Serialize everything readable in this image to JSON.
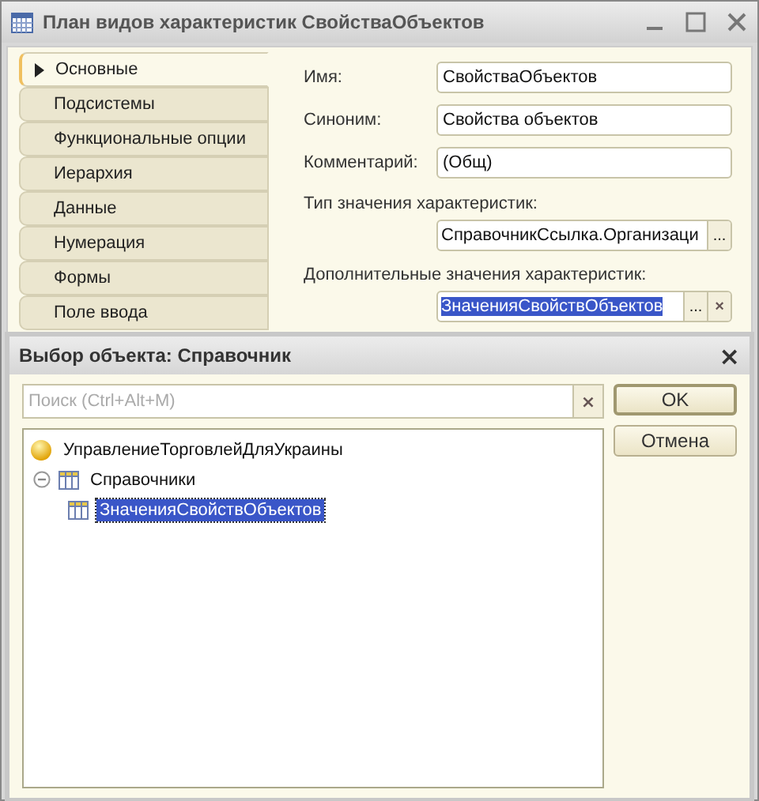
{
  "window": {
    "title": "План видов характеристик СвойстваОбъектов"
  },
  "tabs": [
    {
      "label": "Основные",
      "selected": true
    },
    {
      "label": "Подсистемы",
      "selected": false
    },
    {
      "label": "Функциональные опции",
      "selected": false
    },
    {
      "label": "Иерархия",
      "selected": false
    },
    {
      "label": "Данные",
      "selected": false
    },
    {
      "label": "Нумерация",
      "selected": false
    },
    {
      "label": "Формы",
      "selected": false
    },
    {
      "label": "Поле ввода",
      "selected": false
    }
  ],
  "fields": [
    {
      "kind": "inline",
      "label": "Имя:",
      "value": "СвойстваОбъектов"
    },
    {
      "kind": "inline",
      "label": "Синоним:",
      "value": "Свойства объектов"
    },
    {
      "kind": "inline",
      "label": "Комментарий:",
      "value": "(Общ)"
    },
    {
      "kind": "choice",
      "label": "Тип значения характеристик:",
      "value": "СправочникСсылка.Организаци",
      "button": "...",
      "highlighted": false
    },
    {
      "kind": "choice-clear",
      "label": "Дополнительные значения характеристик:",
      "value": "ЗначенияСвойствОбъектов",
      "button": "...",
      "clear": "×",
      "highlighted": true
    }
  ],
  "dialog": {
    "title": "Выбор объекта: Справочник",
    "close": "×",
    "search": {
      "placeholder": "Поиск (Ctrl+Alt+M)",
      "clear": "×"
    },
    "buttons": [
      {
        "label": "OK",
        "default": true
      },
      {
        "label": "Отмена",
        "default": false
      }
    ],
    "tree": [
      {
        "kind": "root",
        "label": "УправлениеТорговлейДляУкраины",
        "selected": false,
        "children": [
          {
            "kind": "group",
            "label": "Справочники",
            "expanded": true,
            "selected": false,
            "children": [
              {
                "kind": "item",
                "label": "ЗначенияСвойствОбъектов",
                "selected": true
              }
            ]
          }
        ]
      }
    ]
  }
}
